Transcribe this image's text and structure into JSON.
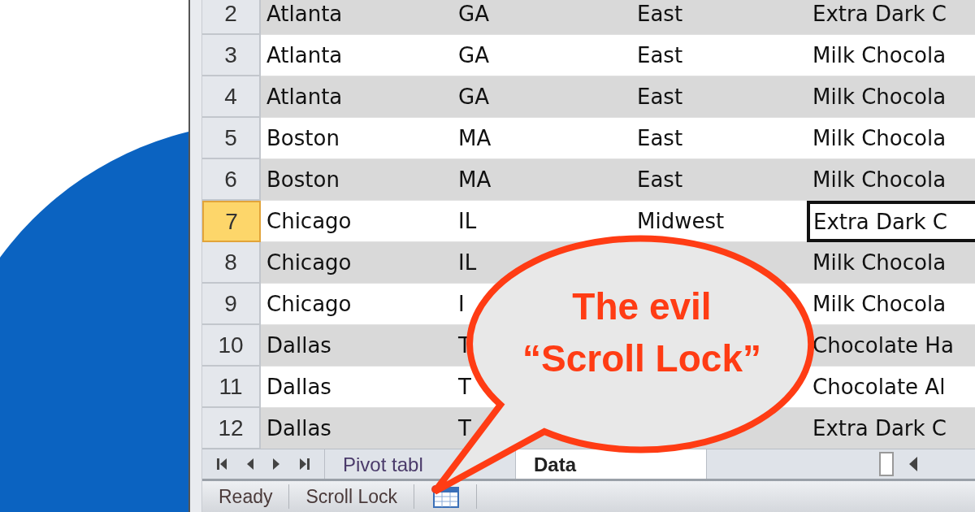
{
  "sheet": {
    "rows": [
      {
        "number": "2",
        "selected": false,
        "cells": [
          "Atlanta",
          "GA",
          "East",
          "Extra Dark C"
        ]
      },
      {
        "number": "3",
        "selected": false,
        "cells": [
          "Atlanta",
          "GA",
          "East",
          "Milk Chocola"
        ]
      },
      {
        "number": "4",
        "selected": false,
        "cells": [
          "Atlanta",
          "GA",
          "East",
          "Milk Chocola"
        ]
      },
      {
        "number": "5",
        "selected": false,
        "cells": [
          "Boston",
          "MA",
          "East",
          "Milk Chocola"
        ]
      },
      {
        "number": "6",
        "selected": false,
        "cells": [
          "Boston",
          "MA",
          "East",
          "Milk Chocola"
        ]
      },
      {
        "number": "7",
        "selected": true,
        "cells": [
          "Chicago",
          "IL",
          "Midwest",
          "Extra Dark C"
        ]
      },
      {
        "number": "8",
        "selected": false,
        "cells": [
          "Chicago",
          "IL",
          null,
          "Milk Chocola"
        ]
      },
      {
        "number": "9",
        "selected": false,
        "cells": [
          "Chicago",
          "I",
          null,
          "Milk Chocola"
        ]
      },
      {
        "number": "10",
        "selected": false,
        "cells": [
          "Dallas",
          "T",
          null,
          "Chocolate Ha"
        ]
      },
      {
        "number": "11",
        "selected": false,
        "cells": [
          "Dallas",
          "T",
          null,
          "Chocolate Al"
        ]
      },
      {
        "number": "12",
        "selected": false,
        "cells": [
          "Dallas",
          "T",
          null,
          "Extra Dark C"
        ]
      }
    ]
  },
  "sheet_tabs": [
    {
      "label": "Pivot tabl",
      "selected": false
    },
    {
      "label": "Data",
      "selected": true
    }
  ],
  "status_bar": {
    "items": [
      "Ready",
      "Scroll Lock"
    ]
  },
  "callout": {
    "lines": [
      "The evil",
      "“Scroll Lock”"
    ]
  }
}
